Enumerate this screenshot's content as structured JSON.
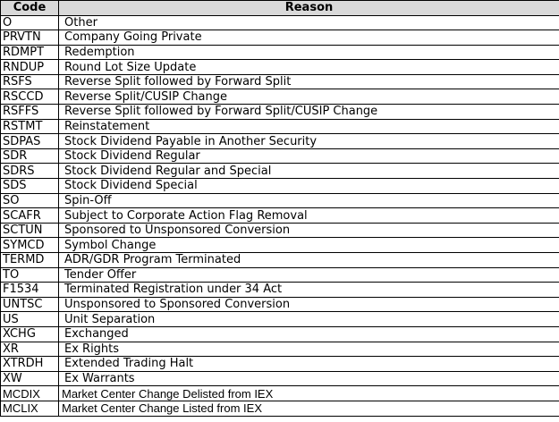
{
  "header": {
    "code": "Code",
    "reason": "Reason"
  },
  "rows": [
    {
      "code": "O",
      "reason": "Other"
    },
    {
      "code": "PRVTN",
      "reason": "Company Going Private"
    },
    {
      "code": "RDMPT",
      "reason": "Redemption"
    },
    {
      "code": "RNDUP",
      "reason": "Round Lot Size Update"
    },
    {
      "code": "RSFS",
      "reason": "Reverse Split followed by Forward Split"
    },
    {
      "code": "RSCCD",
      "reason": "Reverse Split/CUSIP Change"
    },
    {
      "code": "RSFFS",
      "reason": "Reverse Split followed by Forward Split/CUSIP Change"
    },
    {
      "code": "RSTMT",
      "reason": "Reinstatement"
    },
    {
      "code": "SDPAS",
      "reason": "Stock Dividend Payable in Another Security"
    },
    {
      "code": "SDR",
      "reason": "Stock Dividend Regular"
    },
    {
      "code": "SDRS",
      "reason": "Stock Dividend Regular and Special"
    },
    {
      "code": "SDS",
      "reason": "Stock Dividend Special"
    },
    {
      "code": "SO",
      "reason": "Spin-Off"
    },
    {
      "code": "SCAFR",
      "reason": "Subject to Corporate Action Flag Removal"
    },
    {
      "code": "SCTUN",
      "reason": "Sponsored to Unsponsored Conversion"
    },
    {
      "code": "SYMCD",
      "reason": "Symbol Change"
    },
    {
      "code": "TERMD",
      "reason": "ADR/GDR Program Terminated"
    },
    {
      "code": "TO",
      "reason": "Tender Offer"
    },
    {
      "code": "F1534",
      "reason": "Terminated Registration under 34 Act"
    },
    {
      "code": "UNTSC",
      "reason": "Unsponsored to Sponsored Conversion"
    },
    {
      "code": "US",
      "reason": "Unit Separation"
    },
    {
      "code": "XCHG",
      "reason": "Exchanged"
    },
    {
      "code": "XR",
      "reason": "Ex Rights"
    },
    {
      "code": "XTRDH",
      "reason": "Extended Trading Halt"
    },
    {
      "code": "XW",
      "reason": "Ex Warrants"
    },
    {
      "code": "MCDIX",
      "reason": "Market Center Change Delisted from IEX"
    },
    {
      "code": "MCLIX",
      "reason": "Market Center Change Listed from IEX"
    }
  ]
}
